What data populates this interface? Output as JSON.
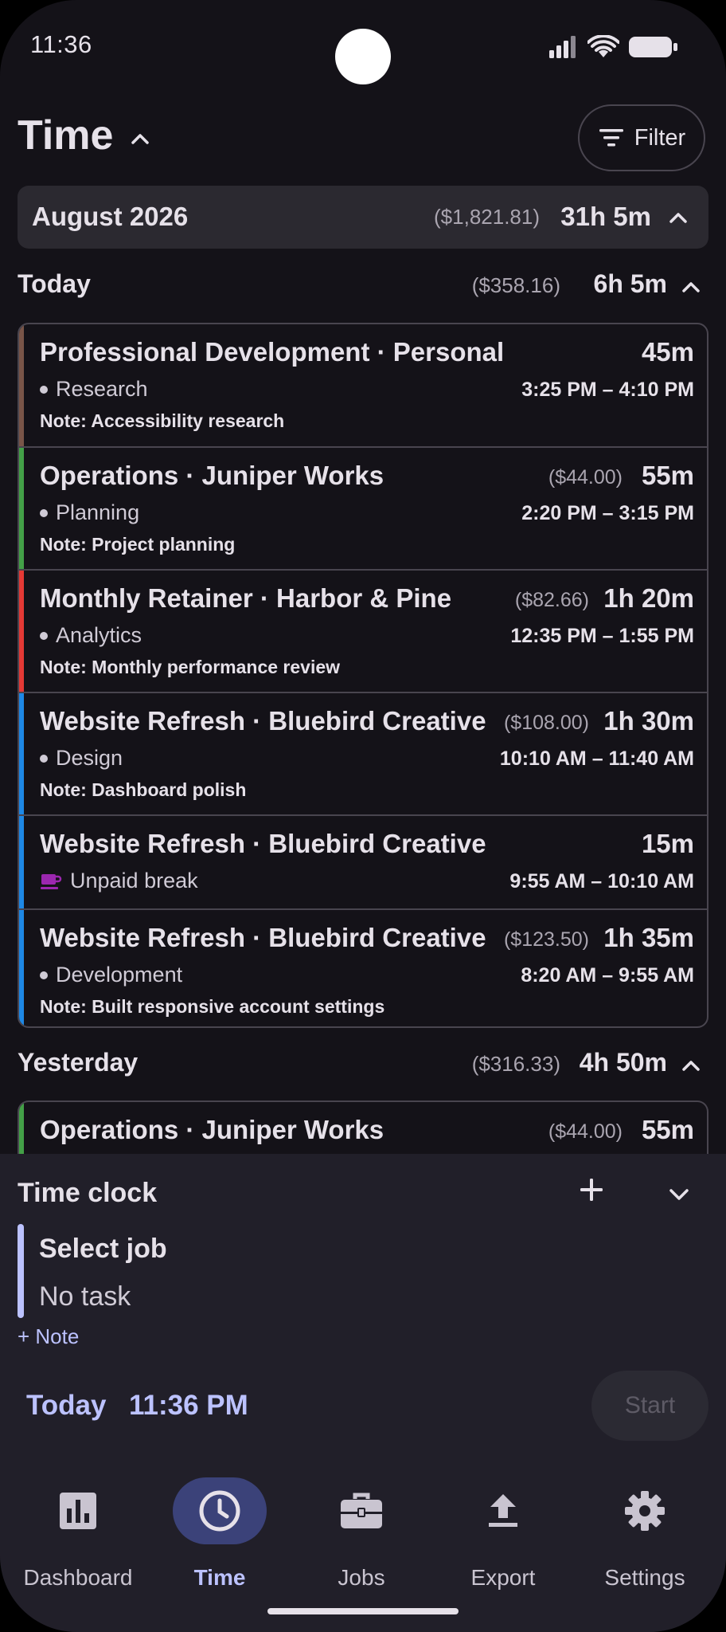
{
  "status": {
    "time": "11:36"
  },
  "header": {
    "title": "Time",
    "filter_label": "Filter"
  },
  "month": {
    "name": "August 2026",
    "amount": "($1,821.81)",
    "duration": "31h 5m"
  },
  "today": {
    "name": "Today",
    "amount": "($358.16)",
    "duration": "6h 5m",
    "entries": [
      {
        "title": "Professional Development · Personal",
        "amount": "",
        "duration": "45m",
        "task": "Research",
        "range": "3:25 PM – 4:10 PM",
        "note": "Note: Accessibility research",
        "color": "#795548"
      },
      {
        "title": "Operations · Juniper Works",
        "amount": "($44.00)",
        "duration": "55m",
        "task": "Planning",
        "range": "2:20 PM – 3:15 PM",
        "note": "Note: Project planning",
        "color": "#43a047"
      },
      {
        "title": "Monthly Retainer · Harbor & Pine",
        "amount": "($82.66)",
        "duration": "1h 20m",
        "task": "Analytics",
        "range": "12:35 PM – 1:55 PM",
        "note": "Note: Monthly performance review",
        "color": "#e53935"
      },
      {
        "title": "Website Refresh · Bluebird Creative",
        "amount": "($108.00)",
        "duration": "1h 30m",
        "task": "Design",
        "range": "10:10 AM – 11:40 AM",
        "note": "Note: Dashboard polish",
        "color": "#1e88e5"
      },
      {
        "title": "Website Refresh · Bluebird Creative",
        "amount": "",
        "duration": "15m",
        "task": "Unpaid break",
        "range": "9:55 AM – 10:10 AM",
        "note": "",
        "color": "#1e88e5"
      },
      {
        "title": "Website Refresh · Bluebird Creative",
        "amount": "($123.50)",
        "duration": "1h 35m",
        "task": "Development",
        "range": "8:20 AM – 9:55 AM",
        "note": "Note: Built responsive account settings",
        "color": "#1e88e5"
      }
    ]
  },
  "yesterday": {
    "name": "Yesterday",
    "amount": "($316.33)",
    "duration": "4h 50m",
    "entries": [
      {
        "title": "Operations · Juniper Works",
        "amount": "($44.00)",
        "duration": "55m",
        "color": "#43a047"
      }
    ]
  },
  "clock": {
    "title": "Time clock",
    "job": "Select job",
    "task": "No task",
    "note_label": "+ Note",
    "day": "Today",
    "time": "11:36 PM",
    "start_label": "Start"
  },
  "nav": {
    "items": [
      {
        "label": "Dashboard",
        "icon": "bar-chart-icon"
      },
      {
        "label": "Time",
        "icon": "clock-icon",
        "active": true
      },
      {
        "label": "Jobs",
        "icon": "briefcase-icon"
      },
      {
        "label": "Export",
        "icon": "upload-icon"
      },
      {
        "label": "Settings",
        "icon": "gear-icon"
      }
    ]
  },
  "colors": {
    "accent": "#bcc2ff",
    "active_pill": "#3b4279",
    "break_icon": "#9c27b0"
  }
}
